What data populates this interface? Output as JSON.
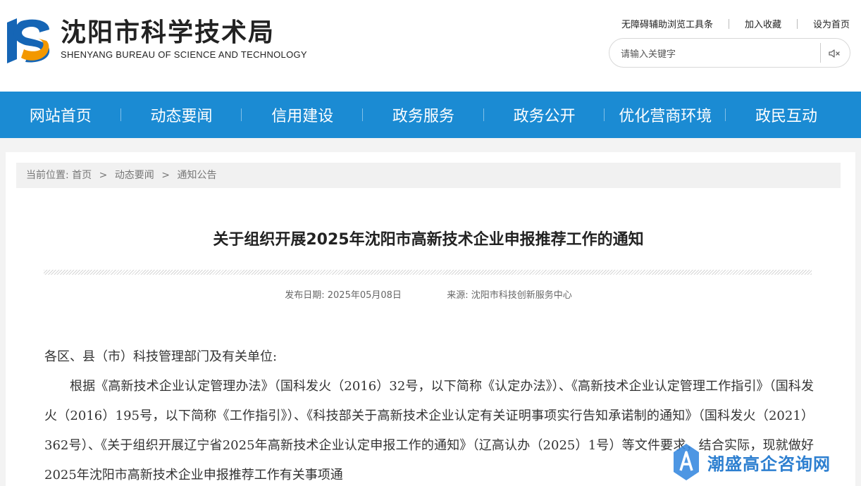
{
  "header": {
    "site_title": "沈阳市科学技术局",
    "site_subtitle": "SHENYANG BUREAU OF SCIENCE AND TECHNOLOGY",
    "top_links": [
      "无障碍辅助浏览工具条",
      "加入收藏",
      "设为首页"
    ],
    "search": {
      "placeholder": "请输入关键字",
      "icon": "voice-icon"
    },
    "logo_colors": {
      "blue": "#1565b5",
      "orange": "#f39800"
    }
  },
  "nav": {
    "items": [
      "网站首页",
      "动态要闻",
      "信用建设",
      "政务服务",
      "政务公开",
      "优化营商环境",
      "政民互动"
    ],
    "background": "#1b8bd3"
  },
  "breadcrumb": {
    "label": "当前位置:",
    "items": [
      "首页",
      "动态要闻",
      "通知公告"
    ],
    "separator": ">"
  },
  "article": {
    "title": "关于组织开展2025年沈阳市高新技术企业申报推荐工作的通知",
    "date_label": "发布日期:",
    "date": "2025年05月08日",
    "source_label": "来源:",
    "source": "沈阳市科技创新服务中心",
    "salutation": "各区、县（市）科技管理部门及有关单位:",
    "paragraph": "根据《高新技术企业认定管理办法》（国科发火（2016）32号，以下简称《认定办法》）、《高新技术企业认定管理工作指引》（国科发火（2016）195号，以下简称《工作指引》）、《科技部关于高新技术企业认定有关证明事项实行告知承诺制的通知》（国科发火（2021）362号）、《关于组织开展辽宁省2025年高新技术企业认定申报工作的通知》（辽高认办（2025）1号）等文件要求，结合实际，现就做好2025年沈阳市高新技术企业申报推荐工作有关事项通"
  },
  "watermark": {
    "text": "潮盛高企咨询网",
    "icon": "a-letter-icon"
  }
}
